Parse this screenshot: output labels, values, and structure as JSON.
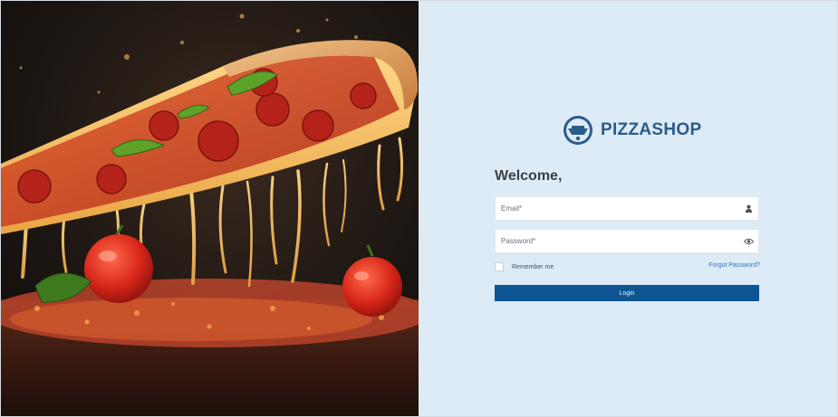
{
  "hero": {
    "image": "pizza-slice-photo"
  },
  "brand": {
    "name": "PIZZASHOP",
    "logo_icon": "pizza-logo-icon",
    "color": "#2c5c8a"
  },
  "login": {
    "heading": "Welcome,",
    "email_placeholder": "Email*",
    "email_icon": "user-icon",
    "password_placeholder": "Password*",
    "password_icon": "eye-icon",
    "remember_label": "Remember me",
    "forgot_label": "Forgot Password?",
    "submit_label": "Login"
  },
  "colors": {
    "panel_bg": "#dcebf6",
    "button_bg": "#0c5592",
    "link": "#2e75c2"
  }
}
